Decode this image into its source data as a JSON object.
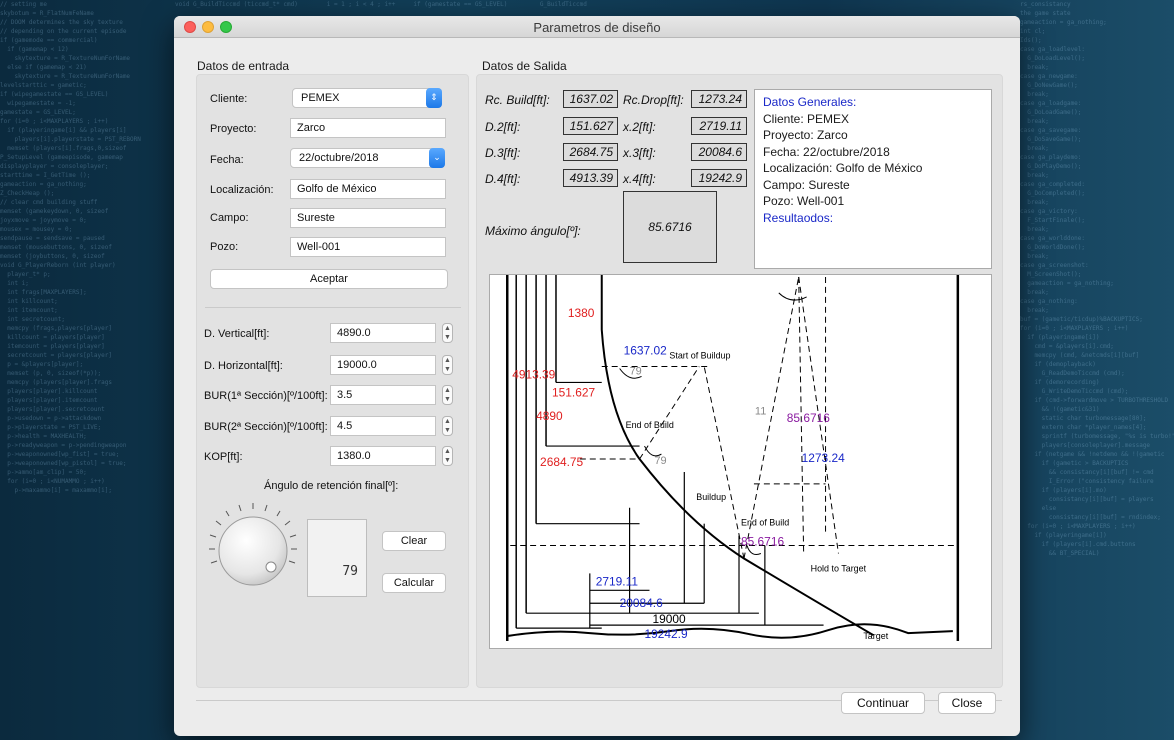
{
  "window": {
    "title": "Parametros de diseño"
  },
  "entrada": {
    "group_title": "Datos de entrada",
    "cliente": {
      "label": "Cliente:",
      "value": "PEMEX"
    },
    "proyecto": {
      "label": "Proyecto:",
      "value": "Zarco"
    },
    "fecha": {
      "label": "Fecha:",
      "value": "22/octubre/2018"
    },
    "localizacion": {
      "label": "Localización:",
      "value": "Golfo de México"
    },
    "campo": {
      "label": "Campo:",
      "value": "Sureste"
    },
    "pozo": {
      "label": "Pozo:",
      "value": "Well-001"
    },
    "aceptar": "Aceptar",
    "d_vertical": {
      "label": "D. Vertical[ft]:",
      "value": "4890.0"
    },
    "d_horizontal": {
      "label": "D. Horizontal[ft]:",
      "value": "19000.0"
    },
    "bur1": {
      "label": "BUR(1ª Sección)[º/100ft]:",
      "value": "3.5"
    },
    "bur2": {
      "label": "BUR(2ª Sección)[º/100ft]:",
      "value": "4.5"
    },
    "kop": {
      "label": "KOP[ft]:",
      "value": "1380.0"
    },
    "angulo_label": "Ángulo de retención final[º]:",
    "lcd_value": "79",
    "clear": "Clear",
    "calcular": "Calcular"
  },
  "salida": {
    "group_title": "Datos de Salida",
    "rc_build": {
      "label": "Rc. Build[ft]:",
      "value": "1637.02"
    },
    "rc_drop": {
      "label": "Rc.Drop[ft]:",
      "value": "1273.24"
    },
    "d2": {
      "label": "D.2[ft]:",
      "value": "151.627"
    },
    "x2": {
      "label": "x.2[ft]:",
      "value": "2719.11"
    },
    "d3": {
      "label": "D.3[ft]:",
      "value": "2684.75"
    },
    "x3": {
      "label": "x.3[ft]:",
      "value": "20084.6"
    },
    "d4": {
      "label": "D.4[ft]:",
      "value": "4913.39"
    },
    "x4": {
      "label": "x.4[ft]:",
      "value": "19242.9"
    },
    "max_angle": {
      "label": "Máximo ángulo[º]:",
      "value": "85.6716"
    },
    "generales": {
      "title": "Datos Generales:",
      "cliente": "Cliente: PEMEX",
      "proyecto": "Proyecto: Zarco",
      "fecha": "Fecha: 22/octubre/2018",
      "localizacion": "Localización: Golfo de México",
      "campo": "Campo: Sureste",
      "pozo": "Pozo: Well-001",
      "resultados": "Resultaodos:"
    }
  },
  "diagram": {
    "kop": "1380",
    "rc_build": "1637.02",
    "start_buildup": "Start of Buildup",
    "angle_top": "79",
    "d4": "4913.39",
    "d2": "151.627",
    "d_vert": "4890",
    "end_of_build": "End of Build",
    "d3": "2684.75",
    "angle_mid": "79",
    "buildup": "Buildup",
    "angle_right": "11",
    "max_angle": "85.6716",
    "rc_drop": "1273.24",
    "end_of_build_2": "End of Build",
    "angle_bottom": "85.6716",
    "hold_to_target": "Hold to Target",
    "x2": "2719.11",
    "x3": "20084.6",
    "x_horiz": "19000",
    "x4": "19242.9",
    "target": "Target"
  },
  "footer": {
    "continuar": "Continuar",
    "close": "Close"
  },
  "colors": {
    "red": "#e02020",
    "blue": "#1a28c8",
    "purple": "#8a1aa0"
  }
}
